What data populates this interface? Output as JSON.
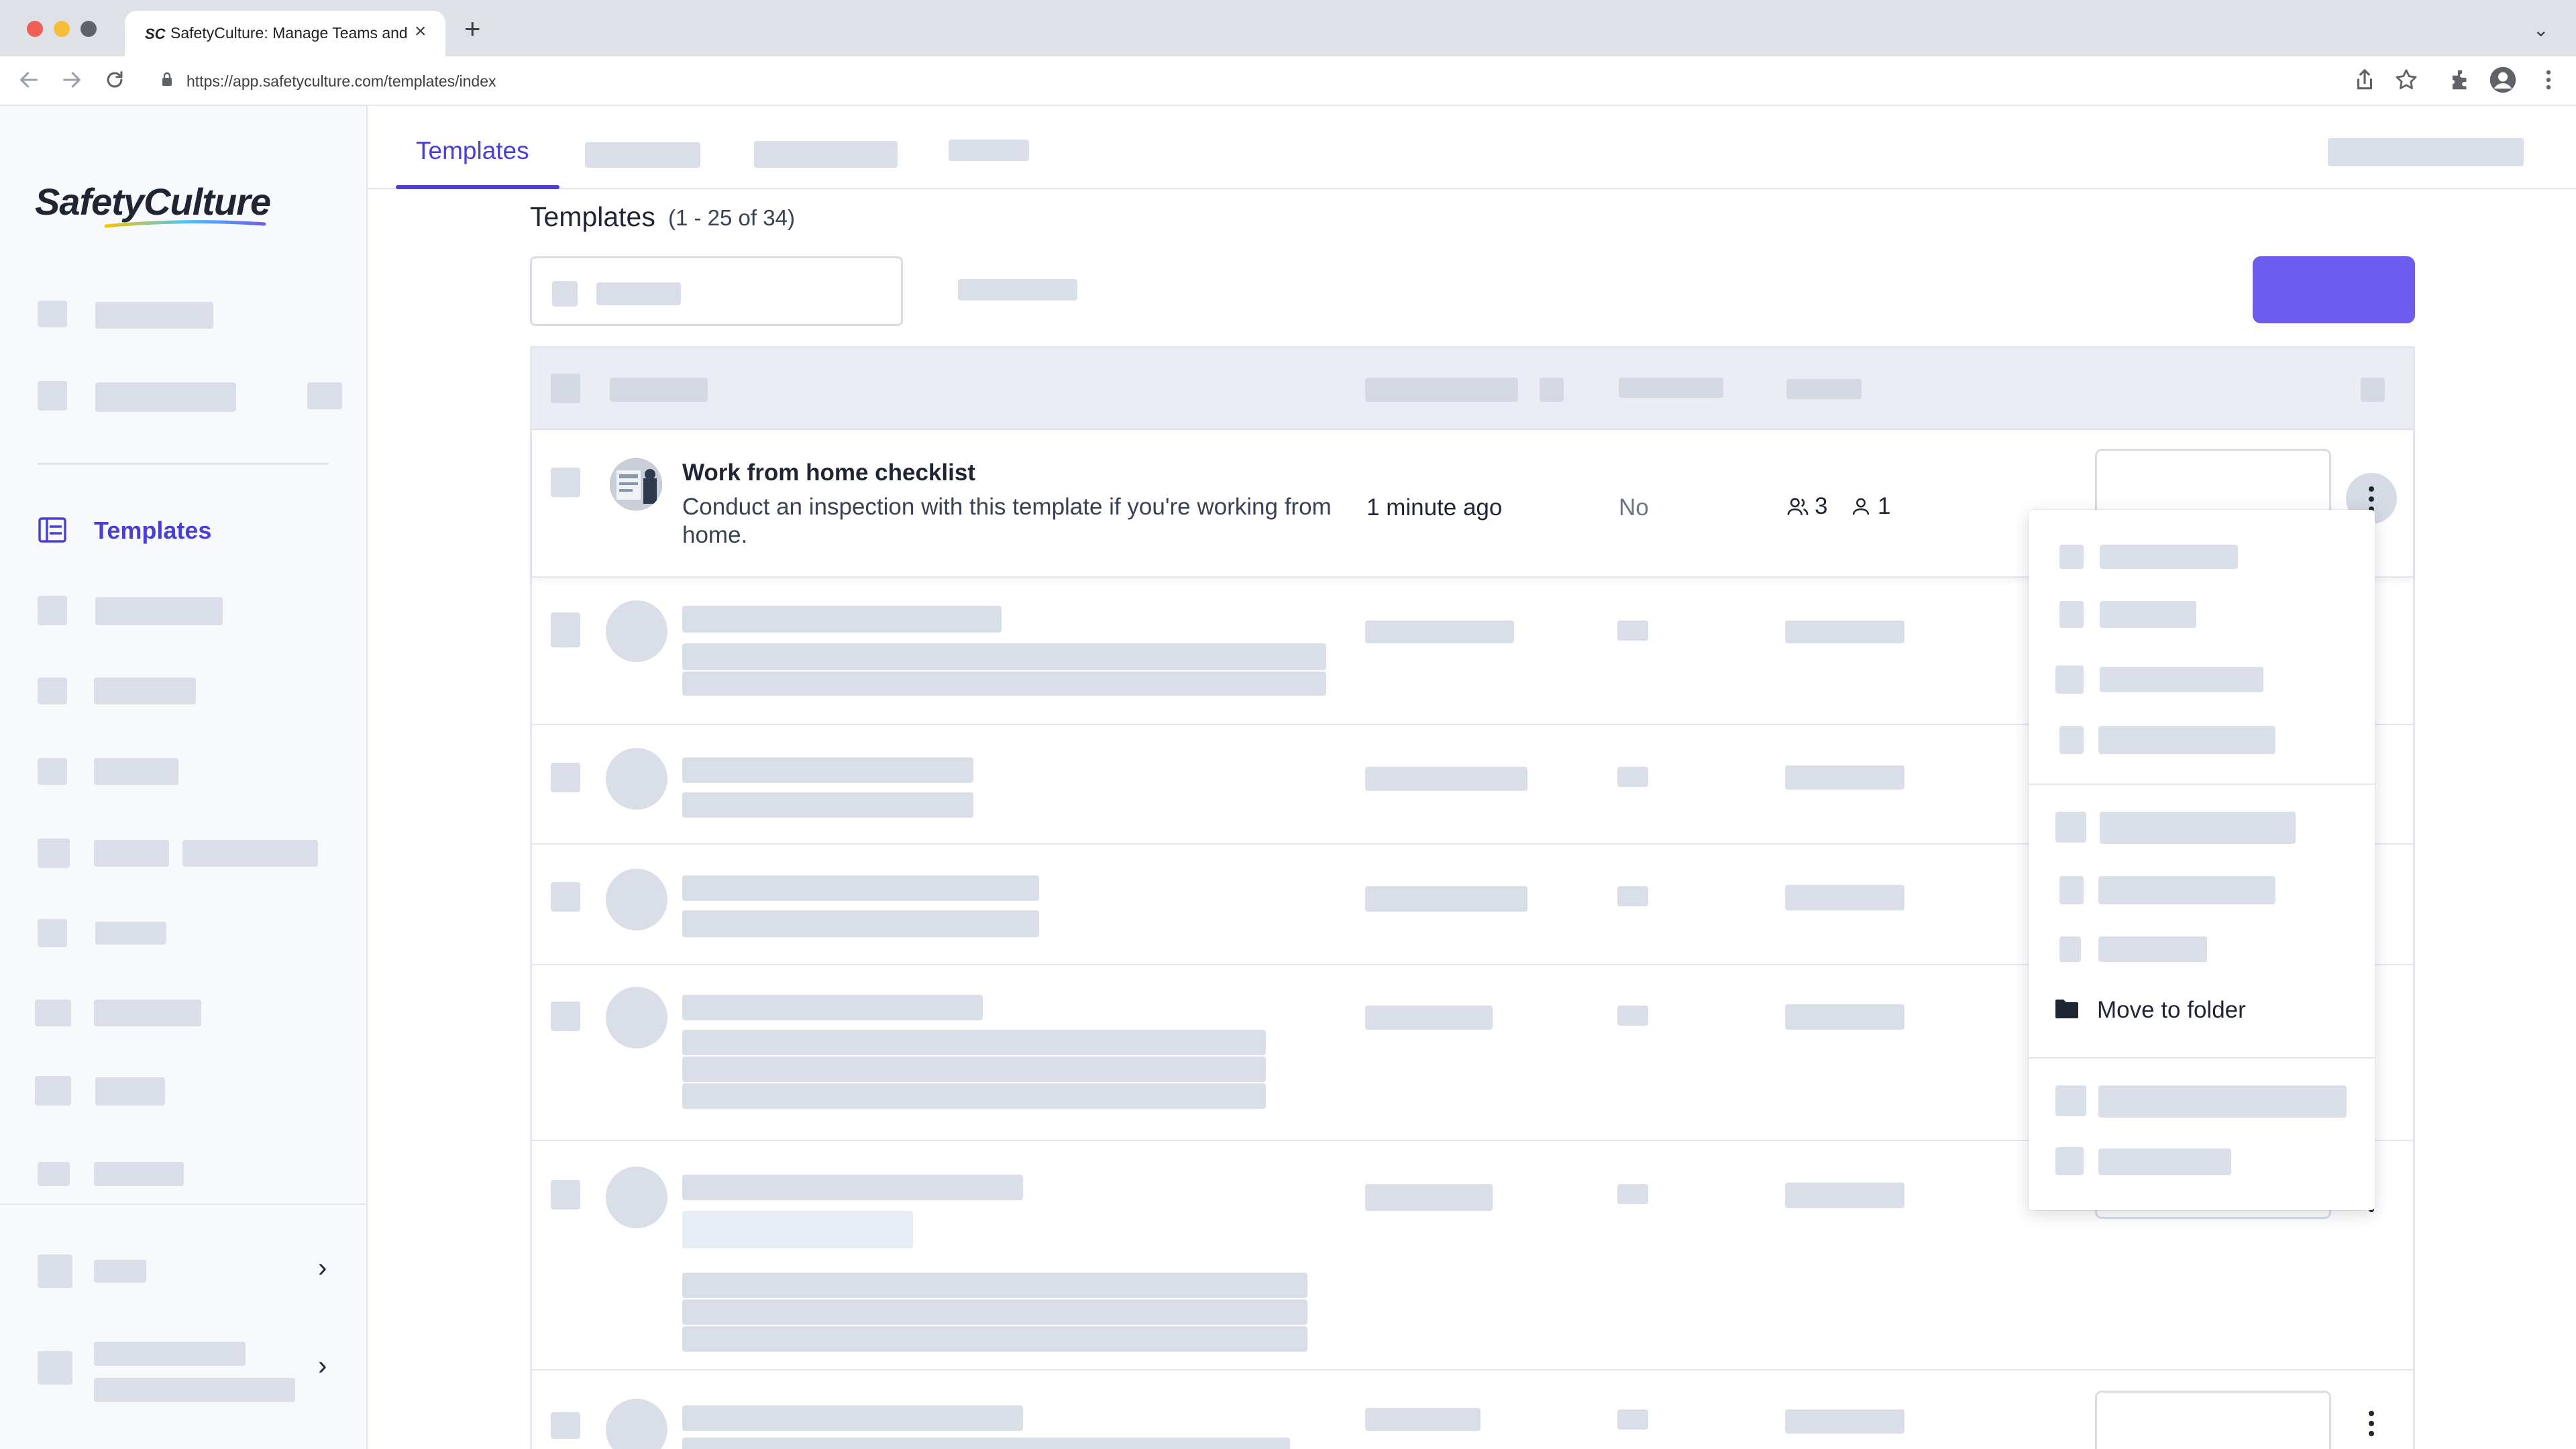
{
  "browser": {
    "tab_favicon": "SC",
    "tab_title": "SafetyCulture: Manage Teams and ...",
    "tab_close": "×",
    "new_tab": "+",
    "tab_menu": "⌄",
    "url": "https://app.safetyculture.com/templates/index",
    "icons": [
      "back-arrow-icon",
      "forward-arrow-icon",
      "reload-icon",
      "lock-icon",
      "share-icon",
      "bookmark-star-icon",
      "extensions-icon",
      "profile-icon",
      "kebab-menu-icon"
    ]
  },
  "sidebar": {
    "logo": "SafetyCulture",
    "active_item": "Templates",
    "chevron": "›"
  },
  "tabs": {
    "active": "Templates"
  },
  "page": {
    "title": "Templates",
    "count": "(1 - 25 of 34)"
  },
  "colors": {
    "accent": "#4a3fd4",
    "create_button": "#6c5cf0",
    "skeleton": "#d9dee9",
    "header_bg": "#eaedf4"
  },
  "row1": {
    "title": "Work from home checklist",
    "description": "Conduct an inspection with this template if you're working from home.",
    "last_modified": "1 minute ago",
    "published": "No",
    "groups_count": "3",
    "users_count": "1"
  },
  "menu": {
    "move_to_folder": "Move to folder"
  }
}
